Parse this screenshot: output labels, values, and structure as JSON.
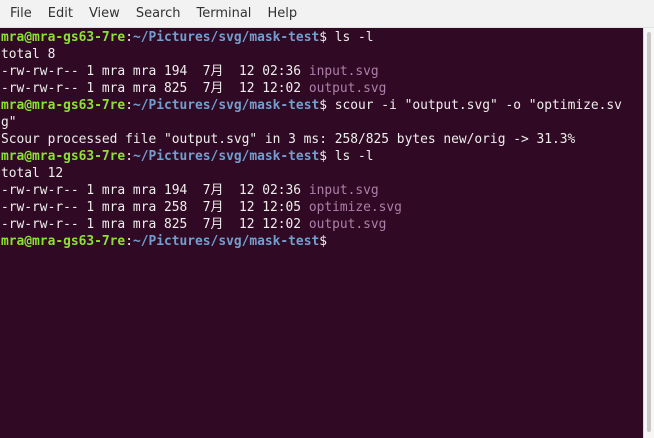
{
  "menu": {
    "file": "File",
    "edit": "Edit",
    "view": "View",
    "search": "Search",
    "terminal": "Terminal",
    "help": "Help"
  },
  "colors": {
    "background": "#300a24",
    "prompt_user": "#8ae234",
    "prompt_path": "#729fcf",
    "svg_file": "#ad7fa8",
    "text": "#eeeeec"
  },
  "prompt": {
    "user": "mra@mra-gs63-7re",
    "colon": ":",
    "path": "~/Pictures/svg/mask-test",
    "dollar": "$"
  },
  "lines": [
    {
      "cmd": " ls -l"
    },
    {
      "text": "total 8"
    },
    {
      "text": "-rw-rw-r-- 1 mra mra 194  7月  12 02:36 ",
      "file": "input.svg"
    },
    {
      "text": "-rw-rw-r-- 1 mra mra 825  7月  12 12:02 ",
      "file": "output.svg"
    },
    {
      "cmd": " scour -i \"output.svg\" -o \"optimize.sv"
    },
    {
      "text": "g\""
    },
    {
      "text": "Scour processed file \"output.svg\" in 3 ms: 258/825 bytes new/orig -> 31.3%"
    },
    {
      "cmd": " ls -l"
    },
    {
      "text": "total 12"
    },
    {
      "text": "-rw-rw-r-- 1 mra mra 194  7月  12 02:36 ",
      "file": "input.svg"
    },
    {
      "text": "-rw-rw-r-- 1 mra mra 258  7月  12 12:05 ",
      "file": "optimize.svg"
    },
    {
      "text": "-rw-rw-r-- 1 mra mra 825  7月  12 12:02 ",
      "file": "output.svg"
    },
    {
      "cmd": ""
    }
  ]
}
